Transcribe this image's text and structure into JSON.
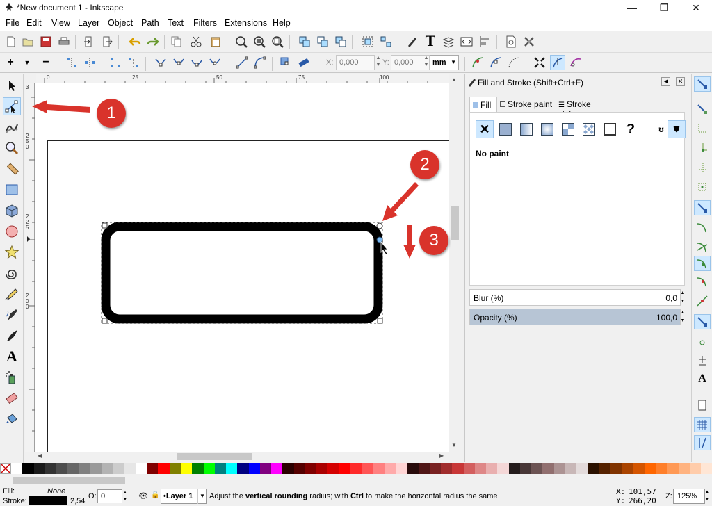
{
  "window": {
    "title": "*New document 1 - Inkscape",
    "minimize_glyph": "—",
    "maximize_glyph": "❐",
    "close_glyph": "✕"
  },
  "menu": {
    "items": [
      "File",
      "Edit",
      "View",
      "Layer",
      "Object",
      "Path",
      "Text",
      "Filters",
      "Extensions",
      "Help"
    ]
  },
  "controls": {
    "x_label": "X:",
    "x_value": "0,000",
    "y_label": "Y:",
    "y_value": "0,000",
    "unit": "mm"
  },
  "ruler": {
    "h_ticks": [
      "0",
      "25",
      "50",
      "75",
      "100"
    ],
    "v_ticks": [
      "3",
      "2 5 0",
      "2 2 5",
      "2 0 0"
    ]
  },
  "panel": {
    "title": "Fill and Stroke (Shift+Ctrl+F)",
    "tabs": [
      "Fill",
      "Stroke paint",
      "Stroke style"
    ],
    "paint_status": "No paint",
    "blur_label": "Blur (%)",
    "blur_value": "0,0",
    "opacity_label": "Opacity (%)",
    "opacity_value": "100,0",
    "opacity_fraction": 1.0
  },
  "status": {
    "fill_label": "Fill:",
    "fill_value": "None",
    "stroke_label": "Stroke:",
    "stroke_width": "2,54",
    "opacity_label": "O:",
    "opacity_value": "0",
    "layer": "•Layer 1",
    "message_parts": [
      "Adjust the ",
      "vertical rounding",
      " radius; with ",
      "Ctrl",
      " to make the horizontal radius the same"
    ],
    "cursor_x_label": "X:",
    "cursor_x": "101,57",
    "cursor_y_label": "Y:",
    "cursor_y": "266,20",
    "zoom_label": "Z:",
    "zoom": "125%"
  },
  "annotations": [
    "1",
    "2",
    "3"
  ],
  "colors": {
    "accent": "#d9332b",
    "active_tool": "#cde8ff",
    "stroke": "#000000"
  },
  "palette": [
    "#ffffff",
    "#000000",
    "#1a1a1a",
    "#333333",
    "#4d4d4d",
    "#666666",
    "#808080",
    "#999999",
    "#b3b3b3",
    "#cccccc",
    "#e6e6e6",
    "#ffffff",
    "#800000",
    "#ff0000",
    "#808000",
    "#ffff00",
    "#008000",
    "#00ff00",
    "#008080",
    "#00ffff",
    "#000080",
    "#0000ff",
    "#800080",
    "#ff00ff",
    "#2b0000",
    "#550000",
    "#800000",
    "#aa0000",
    "#d40000",
    "#ff0000",
    "#ff2a2a",
    "#ff5555",
    "#ff8080",
    "#ffaaaa",
    "#ffd5d5",
    "#280b0b",
    "#501616",
    "#782121",
    "#a02c2c",
    "#c83737",
    "#d35f5f",
    "#de8787",
    "#e9afaf",
    "#f4d7d7",
    "#241c1c",
    "#483737",
    "#6c5353",
    "#916f6f",
    "#ac9393",
    "#c8b7b7",
    "#e3dbdb",
    "#2b1100",
    "#552200",
    "#803300",
    "#aa4400",
    "#d45500",
    "#ff6600",
    "#ff7f2a",
    "#ff9955",
    "#ffb380",
    "#ffccaa",
    "#ffe6d5"
  ]
}
